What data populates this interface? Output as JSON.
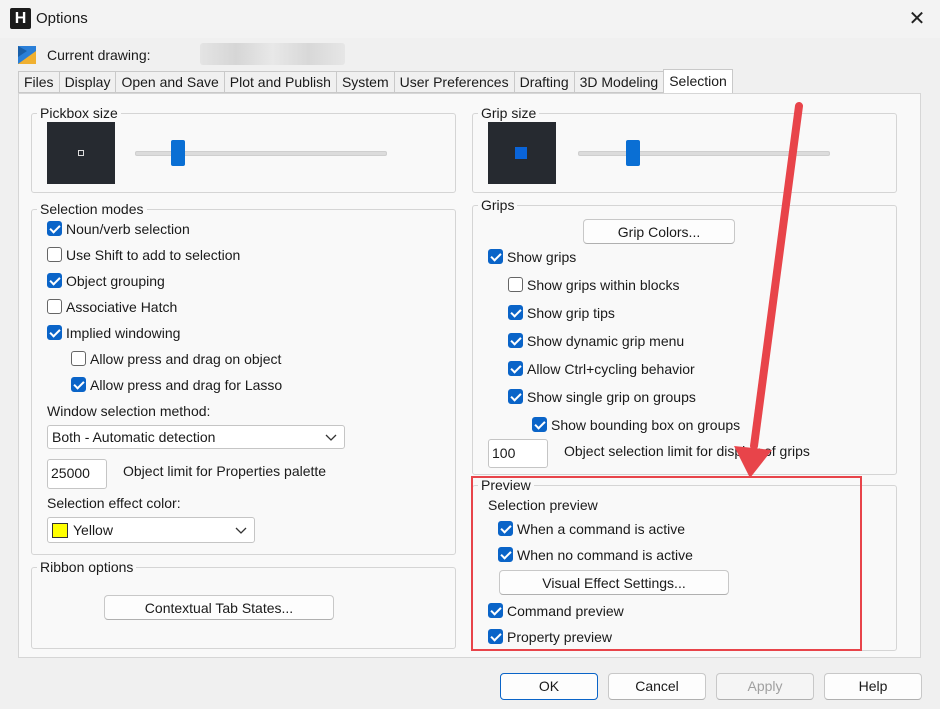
{
  "window": {
    "title": "Options",
    "app_icon": "H"
  },
  "header": {
    "current_drawing_label": "Current drawing:"
  },
  "tabs": [
    "Files",
    "Display",
    "Open and Save",
    "Plot and Publish",
    "System",
    "User Preferences",
    "Drafting",
    "3D Modeling",
    "Selection"
  ],
  "active_tab": "Selection",
  "pickbox": {
    "title": "Pickbox size",
    "level": 0.17
  },
  "grip_size": {
    "title": "Grip size",
    "level": 0.22
  },
  "selection_modes": {
    "title": "Selection modes",
    "options": [
      {
        "label": "Noun/verb selection",
        "checked": true
      },
      {
        "label": "Use Shift to add to selection",
        "checked": false
      },
      {
        "label": "Object grouping",
        "checked": true
      },
      {
        "label": "Associative Hatch",
        "checked": false
      },
      {
        "label": "Implied windowing",
        "checked": true
      },
      {
        "label": "Allow press and drag on object",
        "checked": false
      },
      {
        "label": "Allow press and drag for Lasso",
        "checked": true
      }
    ],
    "window_method_label": "Window selection method:",
    "window_method_value": "Both - Automatic detection",
    "object_limit_value": "25000",
    "object_limit_label": "Object limit for Properties palette",
    "effect_color_label": "Selection effect color:",
    "effect_color_value": "Yellow",
    "effect_color_hex": "#ffff00"
  },
  "ribbon": {
    "title": "Ribbon options",
    "button": "Contextual Tab States..."
  },
  "grips": {
    "title": "Grips",
    "colors_button": "Grip Colors...",
    "options": [
      {
        "label": "Show grips",
        "checked": true
      },
      {
        "label": "Show grips within blocks",
        "checked": false
      },
      {
        "label": "Show grip tips",
        "checked": true
      },
      {
        "label": "Show dynamic grip menu",
        "checked": true
      },
      {
        "label": "Allow Ctrl+cycling behavior",
        "checked": true
      },
      {
        "label": "Show single grip on groups",
        "checked": true
      },
      {
        "label": "Show bounding box on groups",
        "checked": true
      }
    ],
    "limit_value": "100",
    "limit_label": "Object selection limit for display of grips"
  },
  "preview": {
    "title": "Preview",
    "subtitle": "Selection preview",
    "options": [
      {
        "label": "When a command is active",
        "checked": true
      },
      {
        "label": "When no command is active",
        "checked": true
      }
    ],
    "visual_button": "Visual Effect Settings...",
    "command_preview": {
      "label": "Command preview",
      "checked": true
    },
    "property_preview": {
      "label": "Property preview",
      "checked": true
    }
  },
  "footer": {
    "ok": "OK",
    "cancel": "Cancel",
    "apply": "Apply",
    "help": "Help"
  },
  "annotation": {
    "color": "#e8444a"
  }
}
